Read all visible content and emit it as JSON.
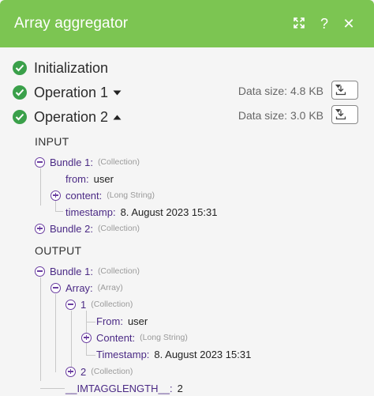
{
  "header": {
    "title": "Array aggregator",
    "help_label": "?",
    "close_label": "✕"
  },
  "operations": [
    {
      "label": "Initialization"
    },
    {
      "label": "Operation 1",
      "data_size": "Data size: 4.8 KB"
    },
    {
      "label": "Operation 2",
      "data_size": "Data size: 3.0 KB"
    }
  ],
  "input": {
    "label": "INPUT",
    "bundle1": {
      "key": "Bundle 1:",
      "type": "(Collection)"
    },
    "from": {
      "key": "from:",
      "value": "user"
    },
    "content": {
      "key": "content:",
      "type": "(Long String)"
    },
    "timestamp": {
      "key": "timestamp:",
      "value": "8. August 2023 15:31"
    },
    "bundle2": {
      "key": "Bundle 2:",
      "type": "(Collection)"
    }
  },
  "output": {
    "label": "OUTPUT",
    "bundle1": {
      "key": "Bundle 1:",
      "type": "(Collection)"
    },
    "array": {
      "key": "Array:",
      "type": "(Array)"
    },
    "item1": {
      "key": "1",
      "type": "(Collection)"
    },
    "from": {
      "key": "From:",
      "value": "user"
    },
    "content": {
      "key": "Content:",
      "type": "(Long String)"
    },
    "timestamp": {
      "key": "Timestamp:",
      "value": "8. August 2023 15:31"
    },
    "item2": {
      "key": "2",
      "type": "(Collection)"
    },
    "length": {
      "key": "__IMTAGGLENGTH__:",
      "value": "2"
    }
  },
  "colors": {
    "header_bg": "#7cc552",
    "success_check": "#3aa04a",
    "tree_key": "#4b2a85"
  }
}
